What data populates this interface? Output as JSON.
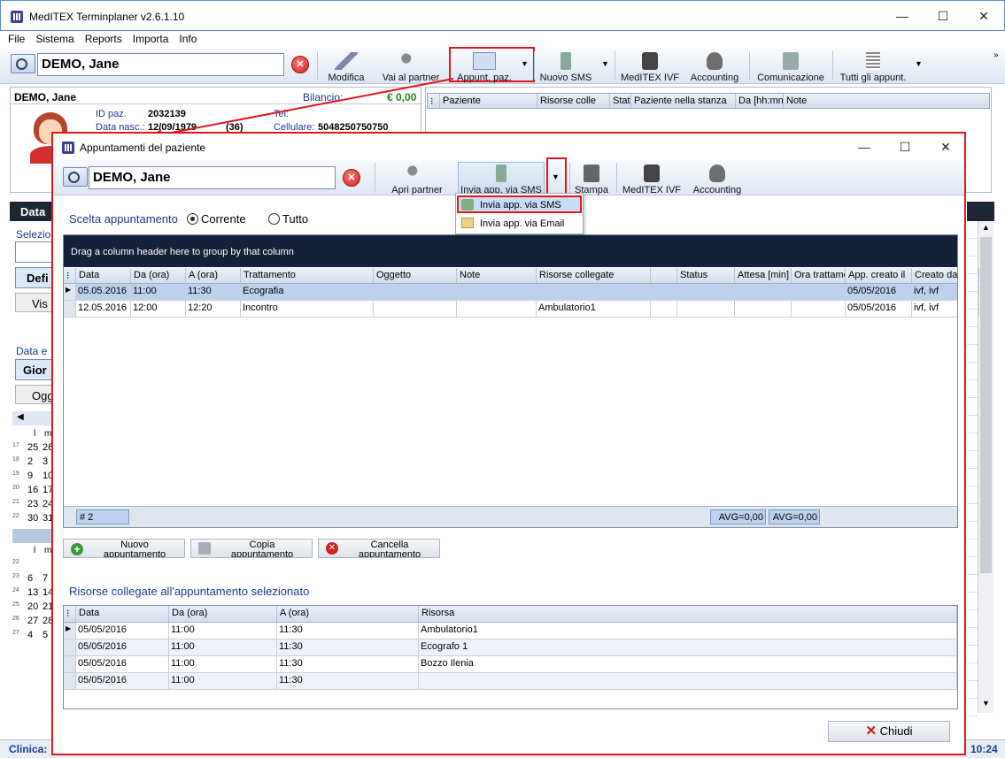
{
  "main_window": {
    "title": "MedITEX Terminplaner  v2.6.1.10",
    "min": "—",
    "max": "☐",
    "close": "✕"
  },
  "menu": [
    "File",
    "Sistema",
    "Reports",
    "Importa",
    "Info"
  ],
  "main_toolbar": {
    "patient": "DEMO, Jane",
    "modifica": "Modifica",
    "vai_partner": "Vai al partner",
    "appunt": "Appunt. paz.",
    "nuovo_sms": "Nuovo SMS",
    "ivf": "MedITEX IVF",
    "accounting": "Accounting",
    "comunicazione": "Comunicazione",
    "tutti": "Tutti gli appunt."
  },
  "patient_card": {
    "name": "DEMO, Jane",
    "bilancio_label": "Bilancio:",
    "bilancio_value": "€ 0,00",
    "id_label": "ID paz.",
    "id_value": "2032139",
    "nasc_label": "Data nasc.:",
    "nasc_value": "12/09/1979",
    "age": "(36)",
    "tel_label": "Tel:",
    "cell_label": "Cellulare:",
    "cell_value": "5048250750750"
  },
  "room_grid_headers": [
    "Paziente",
    "Risorse colle",
    "Stat",
    "Paziente nella stanza",
    "Da [hh:mn",
    "Note"
  ],
  "left_fragments": {
    "data": "Data",
    "sele": "Selezio",
    "defi": "Defi",
    "vis": "Vis",
    "data_e": "Data e",
    "gior": "Gior",
    "ogg": "Ogg",
    "l": "l",
    "m": "m",
    "clinica": "Clinica:",
    "clock": "10:24"
  },
  "calendar1": {
    "weeks": [
      "17",
      "18",
      "19",
      "20",
      "21",
      "22"
    ],
    "rows": [
      [
        "25",
        "26"
      ],
      [
        "2",
        "3"
      ],
      [
        "9",
        "10"
      ],
      [
        "16",
        "17"
      ],
      [
        "23",
        "24"
      ],
      [
        "30",
        "31"
      ]
    ]
  },
  "calendar2": {
    "weeks": [
      "22",
      "23",
      "24",
      "25",
      "26",
      "27"
    ],
    "rows": [
      [
        "",
        ""
      ],
      [
        "6",
        "7"
      ],
      [
        "13",
        "14"
      ],
      [
        "20",
        "21"
      ],
      [
        "27",
        "28"
      ],
      [
        "4",
        "5"
      ]
    ]
  },
  "dialog": {
    "title": "Appuntamenti del paziente",
    "patient": "DEMO, Jane",
    "toolbar": {
      "apri": "Apri partner",
      "invia": "Invia app. via SMS",
      "stampa": "Stampa",
      "ivf": "MedITEX IVF",
      "accounting": "Accounting"
    },
    "dropdown": [
      "Invia app. via SMS",
      "Invia app. via Email"
    ],
    "scelta_label": "Scelta appuntamento",
    "corrente": "Corrente",
    "tutto": "Tutto",
    "group_hint": "Drag a column header here to group by that column",
    "columns": [
      "Data",
      "Da (ora)",
      "A (ora)",
      "Trattamento",
      "Oggetto",
      "Note",
      "Risorse collegate",
      "",
      "Status",
      "Attesa [min]",
      "Ora trattame",
      "App. creato il",
      "Creato da"
    ],
    "rows": [
      [
        "05.05.2016",
        "11:00",
        "11:30",
        "Ecografia",
        "",
        "",
        "",
        "",
        "",
        "",
        "",
        "05/05/2016",
        "ivf, ivf"
      ],
      [
        "12.05.2016",
        "12:00",
        "12:20",
        "Incontro",
        "",
        "",
        "Ambulatorio1",
        "",
        "",
        "",
        "",
        "05/05/2016",
        "ivf, ivf"
      ]
    ],
    "footer_count": "# 2",
    "avg1": "AVG=0,00",
    "avg2": "AVG=0,00",
    "btn_nuovo": "Nuovo appuntamento",
    "btn_copia": "Copia appuntamento",
    "btn_cancella": "Cancella appuntamento",
    "risorse_title": "Risorse collegate all'appuntamento selezionato",
    "res_columns": [
      "Data",
      "Da (ora)",
      "A (ora)",
      "Risorsa"
    ],
    "res_rows": [
      [
        "05/05/2016",
        "11:00",
        "11:30",
        "Ambulatorio1"
      ],
      [
        "05/05/2016",
        "11:00",
        "11:30",
        "Ecografo 1"
      ],
      [
        "05/05/2016",
        "11:00",
        "11:30",
        "Bozzo Ilenia"
      ],
      [
        "05/05/2016",
        "11:00",
        "11:30",
        ""
      ]
    ],
    "chiudi": "Chiudi"
  }
}
